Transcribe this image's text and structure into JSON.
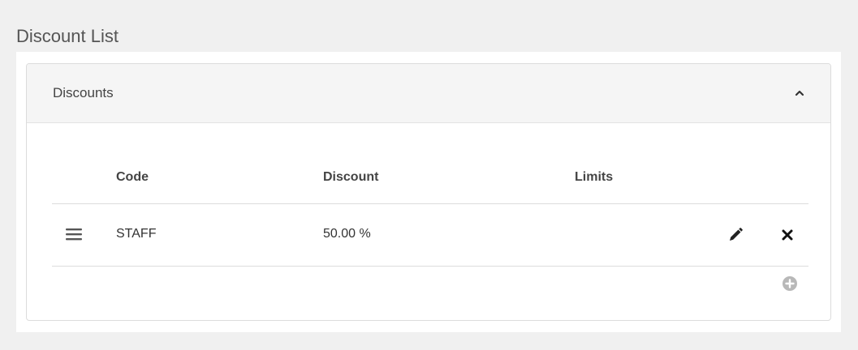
{
  "page": {
    "title": "Discount List"
  },
  "panel": {
    "title": "Discounts"
  },
  "grid": {
    "columns": {
      "code": "Code",
      "discount": "Discount",
      "limits": "Limits"
    },
    "rows": [
      {
        "code": "STAFF",
        "discount": "50.00 %",
        "limits": ""
      }
    ]
  },
  "icons": {
    "collapse": "chevron-up-icon",
    "reorder": "bars-icon",
    "edit": "pencil-icon",
    "delete": "close-icon",
    "add": "plus-circle-icon"
  },
  "colors": {
    "background": "#f0f0f0",
    "header_bg": "#f5f5f5",
    "add_icon": "#b8b8b8"
  }
}
